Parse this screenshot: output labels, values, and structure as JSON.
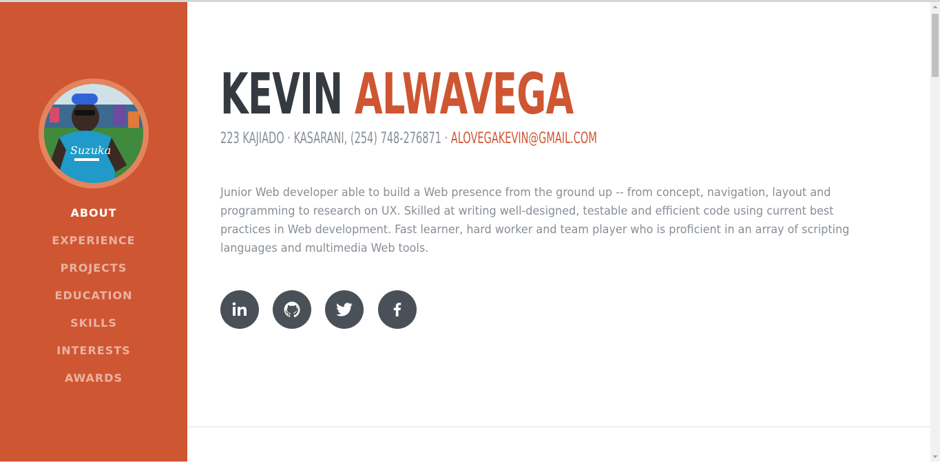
{
  "sidebar": {
    "avatar_alt": "profile photo",
    "nav": [
      {
        "label": "ABOUT",
        "active": true
      },
      {
        "label": "EXPERIENCE",
        "active": false
      },
      {
        "label": "PROJECTS",
        "active": false
      },
      {
        "label": "EDUCATION",
        "active": false
      },
      {
        "label": "SKILLS",
        "active": false
      },
      {
        "label": "INTERESTS",
        "active": false
      },
      {
        "label": "AWARDS",
        "active": false
      }
    ]
  },
  "profile": {
    "first_name": "KEVIN",
    "last_name": "ALWAVEGA",
    "contact_text": "223 KAJIADO · KASARANI, (254) 748-276871 · ",
    "email": "ALOVEGAKEVIN@GMAIL.COM",
    "bio_lines": [
      "Junior Web developer able to build a Web presence from the ground up -- from concept, navigation, layout and",
      "programming to research on UX. Skilled at writing well-designed, testable and efficient code using current best",
      "practices in Web development. Fast learner, hard worker and team player who is proficient in an array of scripting",
      "languages and multimedia Web tools."
    ]
  },
  "social": [
    {
      "name": "linkedin",
      "icon": "linkedin-icon"
    },
    {
      "name": "github",
      "icon": "github-icon"
    },
    {
      "name": "twitter",
      "icon": "twitter-icon"
    },
    {
      "name": "facebook",
      "icon": "facebook-icon"
    }
  ],
  "colors": {
    "accent": "#cf5632",
    "heading": "#343a40",
    "text_muted": "#868e96",
    "social_bg": "#495057"
  }
}
